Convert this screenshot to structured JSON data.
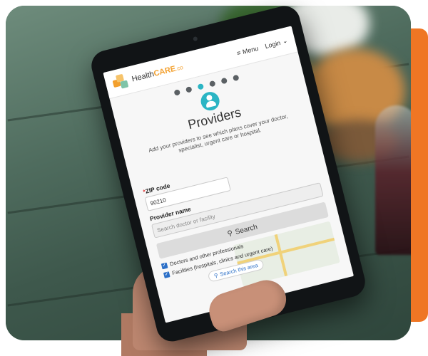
{
  "app": {
    "logo_prefix": "Health",
    "logo_suffix": "CARE",
    "logo_tld": ".co",
    "menu_label": "Menu",
    "login_label": "Login"
  },
  "steps": {
    "total": 6,
    "active_index": 2
  },
  "page": {
    "title": "Providers",
    "subtitle": "Add your providers to see which plans cover your doctor, specialist, urgent care or hospital."
  },
  "form": {
    "zip_label": "ZIP code",
    "zip_required_mark": "*",
    "zip_value": "90210",
    "provider_label": "Provider name",
    "provider_placeholder": "Search doctor or facility",
    "search_button": "Search"
  },
  "filters": {
    "doctors_label": "Doctors and other professionals",
    "doctors_checked": true,
    "facilities_label": "Facilities (hospitals, clinics and urgent care)",
    "facilities_checked": true,
    "search_area_label": "Search this area"
  },
  "colors": {
    "accent": "#2bb5c4",
    "brand_orange": "#f3a02e",
    "stripe_orange": "#ef7624",
    "checkbox_blue": "#2b6fc7"
  },
  "icons": [
    "menu-icon",
    "chevron-down-icon",
    "provider-person-icon",
    "search-icon",
    "check-icon"
  ]
}
